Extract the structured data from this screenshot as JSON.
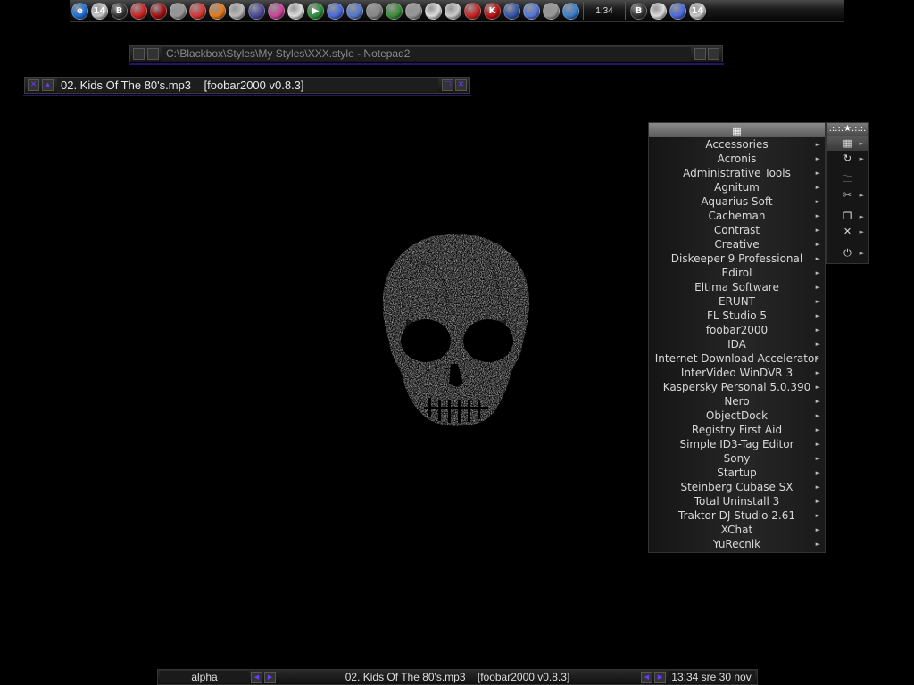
{
  "dock": {
    "clock": "1:34",
    "icons": [
      {
        "name": "ie-icon",
        "glyph": "e",
        "color": "#1e6fd8"
      },
      {
        "name": "calendar-icon",
        "glyph": "14",
        "color": "#c8c8c8"
      },
      {
        "name": "blackbox-b-icon",
        "glyph": "B",
        "color": "#333"
      },
      {
        "name": "lifebuoy-icon",
        "glyph": "",
        "color": "#c22"
      },
      {
        "name": "record-red-icon",
        "glyph": "",
        "color": "#a01010"
      },
      {
        "name": "itunes-icon",
        "glyph": "",
        "color": "#999"
      },
      {
        "name": "diamond-red-icon",
        "glyph": "",
        "color": "#d33"
      },
      {
        "name": "fl-studio-icon",
        "glyph": "",
        "color": "#e87b1a"
      },
      {
        "name": "cd-icon",
        "glyph": "",
        "color": "#bbb"
      },
      {
        "name": "launcher-icon",
        "glyph": "",
        "color": "#4a4a9a"
      },
      {
        "name": "colors-icon",
        "glyph": "",
        "color": "#c49"
      },
      {
        "name": "flower-icon",
        "glyph": "",
        "color": "#ddd"
      },
      {
        "name": "play-icon",
        "glyph": "▶",
        "color": "#2c8f3a"
      },
      {
        "name": "monitor-icon",
        "glyph": "",
        "color": "#4a6adf"
      },
      {
        "name": "notepad-icon",
        "glyph": "",
        "color": "#5577cc"
      },
      {
        "name": "tools-icon",
        "glyph": "",
        "color": "#888"
      },
      {
        "name": "gear-green-icon",
        "glyph": "",
        "color": "#3a8f3a"
      },
      {
        "name": "gear-icon",
        "glyph": "",
        "color": "#999"
      },
      {
        "name": "gear-white-icon",
        "glyph": "",
        "color": "#ddd"
      },
      {
        "name": "target-icon",
        "glyph": "",
        "color": "#ccc"
      },
      {
        "name": "hand-icon",
        "glyph": "",
        "color": "#c22"
      },
      {
        "name": "kaspersky-icon",
        "glyph": "K",
        "color": "#b11"
      },
      {
        "name": "globe-icon",
        "glyph": "",
        "color": "#3355aa"
      },
      {
        "name": "network-icon",
        "glyph": "",
        "color": "#5577dd"
      },
      {
        "name": "tools2-icon",
        "glyph": "",
        "color": "#999"
      },
      {
        "name": "bubble-icon",
        "glyph": "",
        "color": "#3a7fd0"
      }
    ],
    "tray_icons": [
      {
        "name": "tray-b-icon",
        "glyph": "B",
        "color": "#333"
      },
      {
        "name": "tray-flower-icon",
        "glyph": "",
        "color": "#ddd"
      },
      {
        "name": "tray-monitor-icon",
        "glyph": "",
        "color": "#4a6adf"
      },
      {
        "name": "tray-calendar-icon",
        "glyph": "14",
        "color": "#c8c8c8"
      }
    ]
  },
  "windows": {
    "notepad": {
      "title": "C:\\Blackbox\\Styles\\My Styles\\XXX.style - Notepad2"
    },
    "foobar": {
      "title": "02. Kids Of The 80's.mp3    [foobar2000 v0.8.3]"
    }
  },
  "menu": {
    "title_icon": "▦",
    "items": [
      "Accessories",
      "Acronis",
      "Administrative Tools",
      "Agnitum",
      "Aquarius Soft",
      "Cacheman",
      "Contrast",
      "Creative",
      "Diskeeper 9 Professional",
      "Edirol",
      "Eltima Software",
      "ERUNT",
      "FL Studio 5",
      "foobar2000",
      "IDA",
      "Internet Download Accelerator",
      "InterVideo WinDVR 3",
      "Kaspersky Personal 5.0.390",
      "Nero",
      "ObjectDock",
      "Registry First Aid",
      "Simple ID3-Tag Editor",
      "Sony",
      "Startup",
      "Steinberg Cubase SX",
      "Total Uninstall 3",
      "Traktor DJ Studio 2.61",
      "XChat",
      "YuRecnik"
    ]
  },
  "root_menu": {
    "title": ".:.:.★.:.:.",
    "items": [
      {
        "name": "programs-icon",
        "glyph": "▦",
        "submenu": true,
        "active": true
      },
      {
        "name": "refresh-icon",
        "glyph": "↻",
        "submenu": true
      },
      {
        "gap": true
      },
      {
        "name": "folder-icon",
        "glyph": "🗀",
        "submenu": false
      },
      {
        "name": "tools-icon",
        "glyph": "✂",
        "submenu": true
      },
      {
        "gap": true
      },
      {
        "name": "windows-icon",
        "glyph": "❐",
        "submenu": true
      },
      {
        "name": "blackbox-icon",
        "glyph": "✕",
        "submenu": true
      },
      {
        "gap": true
      },
      {
        "name": "power-icon",
        "glyph": "⏻",
        "submenu": true
      }
    ]
  },
  "toolbar": {
    "workspace": "alpha",
    "task": "02. Kids Of The 80's.mp3    [foobar2000 v0.8.3]",
    "clock": "13:34 sre 30 nov"
  }
}
